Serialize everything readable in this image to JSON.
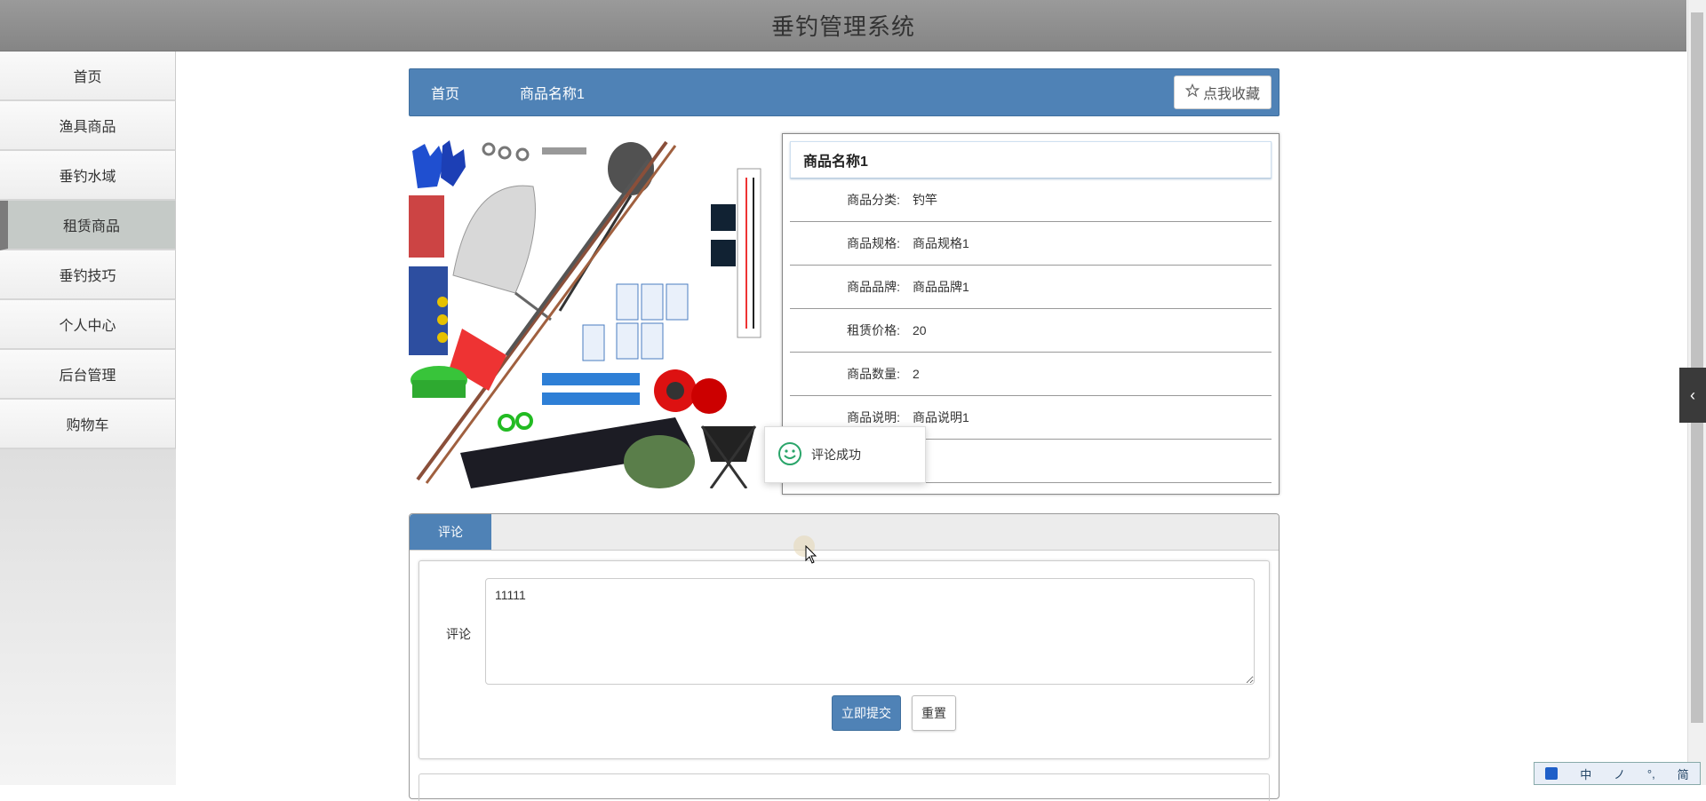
{
  "app": {
    "title": "垂钓管理系统"
  },
  "sidebar": {
    "items": [
      {
        "label": "首页"
      },
      {
        "label": "渔具商品"
      },
      {
        "label": "垂钓水域"
      },
      {
        "label": "租赁商品",
        "active": true
      },
      {
        "label": "垂钓技巧"
      },
      {
        "label": "个人中心"
      },
      {
        "label": "后台管理"
      },
      {
        "label": "购物车"
      }
    ]
  },
  "breadcrumb": {
    "home": "首页",
    "current": "商品名称1"
  },
  "favorite": {
    "label": "点我收藏",
    "icon": "star-outline-icon"
  },
  "product": {
    "name": "商品名称1",
    "fields": [
      {
        "label": "商品分类:",
        "value": "钓竿"
      },
      {
        "label": "商品规格:",
        "value": "商品规格1"
      },
      {
        "label": "商品品牌:",
        "value": "商品品牌1"
      },
      {
        "label": "租赁价格:",
        "value": "20"
      },
      {
        "label": "商品数量:",
        "value": "2"
      },
      {
        "label": "商品说明:",
        "value": "商品说明1"
      },
      {
        "label": "",
        "value": ""
      }
    ]
  },
  "toast": {
    "message": "评论成功",
    "icon": "smile-icon"
  },
  "comment": {
    "tab_label": "评论",
    "field_label": "评论",
    "value": "11111",
    "submit_label": "立即提交",
    "reset_label": "重置"
  },
  "ime": {
    "items": [
      "中",
      "ノ",
      "°,",
      "简"
    ]
  },
  "colors": {
    "accent": "#4f82b6",
    "header": "#8c8c8c"
  }
}
